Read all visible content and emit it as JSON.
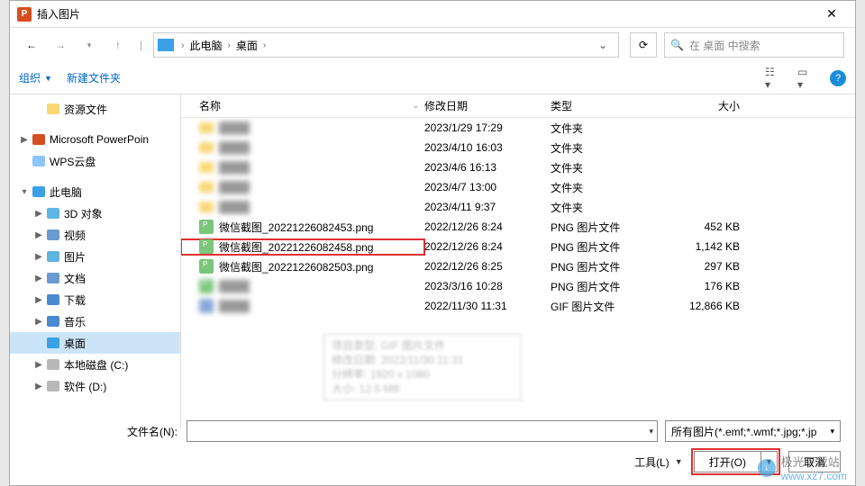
{
  "dialog": {
    "title": "插入图片",
    "app_icon_letter": "P"
  },
  "nav": {
    "path_segments": [
      "此电脑",
      "桌面"
    ],
    "search_placeholder": "在 桌面 中搜索"
  },
  "toolbar": {
    "organize": "组织",
    "new_folder": "新建文件夹"
  },
  "sidebar": {
    "items": [
      {
        "label": "资源文件",
        "icon": "folder",
        "depth": 1,
        "expander": ""
      },
      {
        "label": "Microsoft PowerPoin",
        "icon": "ppt",
        "depth": 0,
        "expander": "▶"
      },
      {
        "label": "WPS云盘",
        "icon": "cloud",
        "depth": 0,
        "expander": ""
      },
      {
        "label": "此电脑",
        "icon": "pc",
        "depth": 0,
        "expander": "▾"
      },
      {
        "label": "3D 对象",
        "icon": "3d",
        "depth": 1,
        "expander": "▶"
      },
      {
        "label": "视频",
        "icon": "video",
        "depth": 1,
        "expander": "▶"
      },
      {
        "label": "图片",
        "icon": "pictures",
        "depth": 1,
        "expander": "▶"
      },
      {
        "label": "文档",
        "icon": "docs",
        "depth": 1,
        "expander": "▶"
      },
      {
        "label": "下载",
        "icon": "downloads",
        "depth": 1,
        "expander": "▶"
      },
      {
        "label": "音乐",
        "icon": "music",
        "depth": 1,
        "expander": "▶"
      },
      {
        "label": "桌面",
        "icon": "desktop",
        "depth": 1,
        "expander": "",
        "selected": true
      },
      {
        "label": "本地磁盘 (C:)",
        "icon": "drive",
        "depth": 1,
        "expander": "▶"
      },
      {
        "label": "软件 (D:)",
        "icon": "drive",
        "depth": 1,
        "expander": "▶"
      }
    ]
  },
  "columns": {
    "name": "名称",
    "date": "修改日期",
    "type": "类型",
    "size": "大小"
  },
  "rows": [
    {
      "name": "",
      "date": "2023/1/29 17:29",
      "type": "文件夹",
      "size": "",
      "icon": "folder",
      "blurred": true
    },
    {
      "name": "",
      "date": "2023/4/10 16:03",
      "type": "文件夹",
      "size": "",
      "icon": "folder",
      "blurred": true
    },
    {
      "name": "",
      "date": "2023/4/6 16:13",
      "type": "文件夹",
      "size": "",
      "icon": "folder",
      "blurred": true
    },
    {
      "name": "",
      "date": "2023/4/7 13:00",
      "type": "文件夹",
      "size": "",
      "icon": "folder",
      "blurred": true
    },
    {
      "name": "",
      "date": "2023/4/11 9:37",
      "type": "文件夹",
      "size": "",
      "icon": "folder",
      "blurred": true
    },
    {
      "name": "微信截图_20221226082453.png",
      "date": "2022/12/26 8:24",
      "type": "PNG 图片文件",
      "size": "452 KB",
      "icon": "png"
    },
    {
      "name": "微信截图_20221226082458.png",
      "date": "2022/12/26 8:24",
      "type": "PNG 图片文件",
      "size": "1,142 KB",
      "icon": "png",
      "highlighted": true
    },
    {
      "name": "微信截图_20221226082503.png",
      "date": "2022/12/26 8:25",
      "type": "PNG 图片文件",
      "size": "297 KB",
      "icon": "png"
    },
    {
      "name": "",
      "date": "2023/3/16 10:28",
      "type": "PNG 图片文件",
      "size": "176 KB",
      "icon": "png",
      "blurred": true
    },
    {
      "name": "",
      "date": "2022/11/30 11:31",
      "type": "GIF 图片文件",
      "size": "12,866 KB",
      "icon": "gif",
      "blurred": true
    }
  ],
  "tooltip": {
    "l1": "项目类型: GIF 图片文件",
    "l2": "修改日期: 2022/11/30 11:31",
    "l3": "分辨率: 1920 x 1080",
    "l4": "大小: 12.5 MB"
  },
  "footer": {
    "filename_label": "文件名(N):",
    "filter_label": "所有图片(*.emf;*.wmf;*.jpg;*.jp",
    "tools": "工具(L)",
    "open": "打开(O)",
    "cancel": "取消"
  },
  "watermark": {
    "name": "极光下载站",
    "url": "www.xz7.com"
  }
}
